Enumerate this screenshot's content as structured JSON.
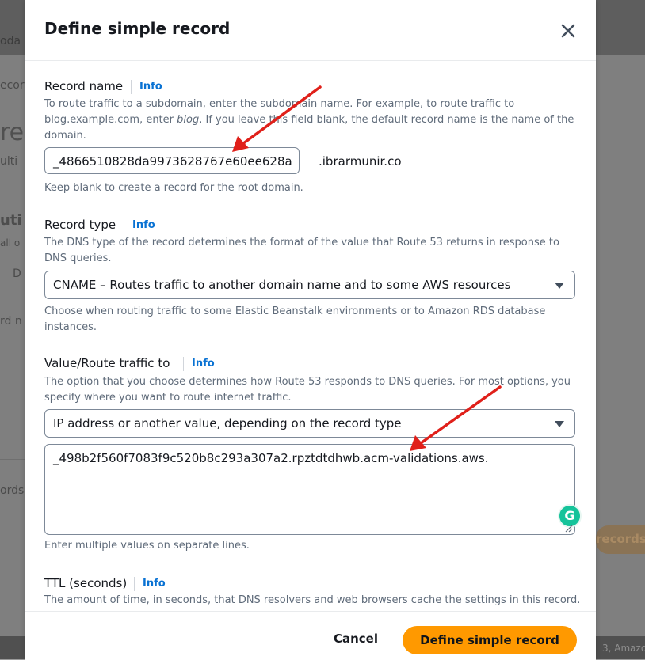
{
  "background": {
    "fragments": [
      "oda",
      "ecord",
      "re",
      "ulti",
      "uti",
      "all o",
      "D",
      "rd n",
      "ords",
      "records",
      "3, Amazo"
    ]
  },
  "modal": {
    "title": "Define simple record",
    "close_icon": "close-icon"
  },
  "record_name": {
    "label": "Record name",
    "info": "Info",
    "description_pre": "To route traffic to a subdomain, enter the subdomain name. For example, to route traffic to blog.example.com, enter ",
    "description_em": "blog",
    "description_post": ". If you leave this field blank, the default record name is the name of the domain.",
    "value": "_4866510828da9973628767e60ee628a",
    "suffix": ".ibrarmunir.co",
    "hint": "Keep blank to create a record for the root domain."
  },
  "record_type": {
    "label": "Record type",
    "info": "Info",
    "description": "The DNS type of the record determines the format of the value that Route 53 returns in response to DNS queries.",
    "selected": "CNAME – Routes traffic to another domain name and to some AWS resources",
    "hint": "Choose when routing traffic to some Elastic Beanstalk environments or to Amazon RDS database instances."
  },
  "value_route": {
    "label": "Value/Route traffic to",
    "info": "Info",
    "description": "The option that you choose determines how Route 53 responds to DNS queries. For most options, you specify where you want to route internet traffic.",
    "selected": "IP address or another value, depending on the record type",
    "value": "_498b2f560f7083f9c520b8c293a307a2.rpztdtdhwb.acm-validations.aws.",
    "grammarly": "G",
    "hint": "Enter multiple values on separate lines."
  },
  "ttl": {
    "label": "TTL (seconds)",
    "info": "Info",
    "description": "The amount of time, in seconds, that DNS resolvers and web browsers cache the settings in this record."
  },
  "footer": {
    "cancel": "Cancel",
    "submit": "Define simple record"
  },
  "colors": {
    "primary": "#ff9900",
    "link": "#0972d3",
    "annotation_arrow": "#e0201a"
  }
}
